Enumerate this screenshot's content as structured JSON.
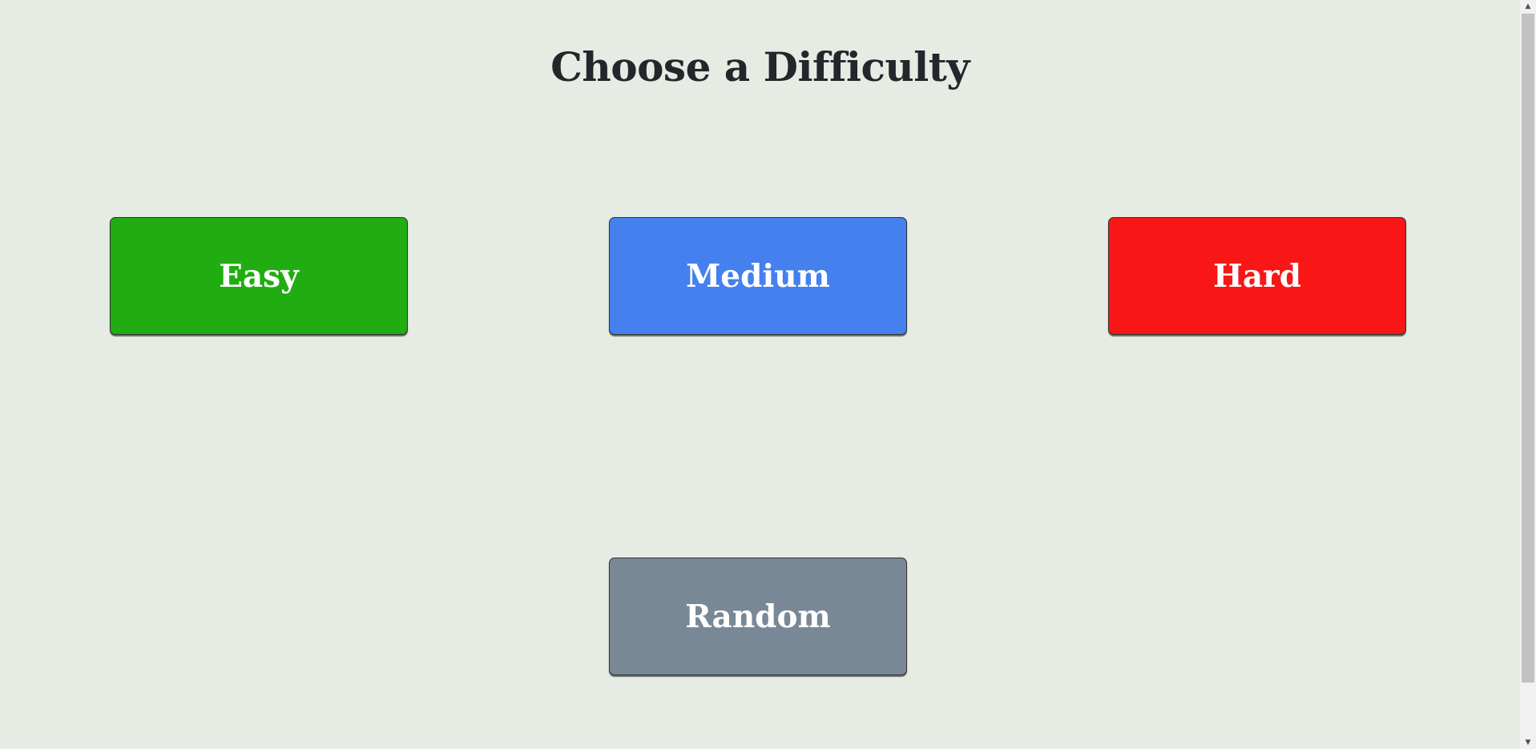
{
  "title": "Choose a Difficulty",
  "buttons": {
    "easy": {
      "label": "Easy",
      "color": "#21ad12"
    },
    "medium": {
      "label": "Medium",
      "color": "#4480ee"
    },
    "hard": {
      "label": "Hard",
      "color": "#f81616"
    },
    "random": {
      "label": "Random",
      "color": "#788896"
    }
  },
  "scrollbar": {
    "up_icon": "scroll-up-arrow-icon",
    "down_icon": "scroll-down-arrow-icon"
  }
}
